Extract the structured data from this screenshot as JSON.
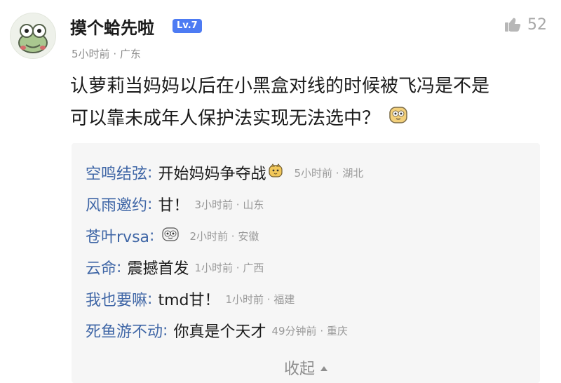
{
  "post": {
    "author": "摸个蛤先啦",
    "level": "Lv.7",
    "like_count": "52",
    "time": "5小时前",
    "location": "广东",
    "content_line_1": "认萝莉当妈妈以后在小黑盒对线的时候被飞冯是不是",
    "content_line_2": "可以靠未成年人保护法实现无法选中？"
  },
  "replies": [
    {
      "name": "空鸣结弦",
      "text": "开始妈妈争夺战",
      "time": "5小时前",
      "location": "湖北",
      "emoji": "dog-emoji"
    },
    {
      "name": "风雨邀约",
      "text": "甘！",
      "time": "3小时前",
      "location": "山东",
      "emoji": ""
    },
    {
      "name": "苍叶rvsa",
      "text": "",
      "time": "2小时前",
      "location": "安徽",
      "emoji": "face-emoji"
    },
    {
      "name": "云命",
      "text": "震撼首发",
      "time": "1小时前",
      "location": "广西",
      "emoji": ""
    },
    {
      "name": "我也要嘛",
      "text": "tmd甘！",
      "time": "1小时前",
      "location": "福建",
      "emoji": ""
    },
    {
      "name": "死鱼游不动",
      "text": "你真是个天才",
      "time": "49分钟前",
      "location": "重庆",
      "emoji": ""
    }
  ],
  "collapse_label": "收起",
  "meta_separator": "·",
  "colors": {
    "link": "#3f66a6",
    "muted": "#999999",
    "level": "#4d7bf3",
    "background": "#f6f6f6"
  },
  "icons": {
    "avatar": "frog-avatar",
    "like": "thumb-up-icon",
    "post_emoji": "cat-face-emoji",
    "collapse": "caret-up-icon"
  }
}
